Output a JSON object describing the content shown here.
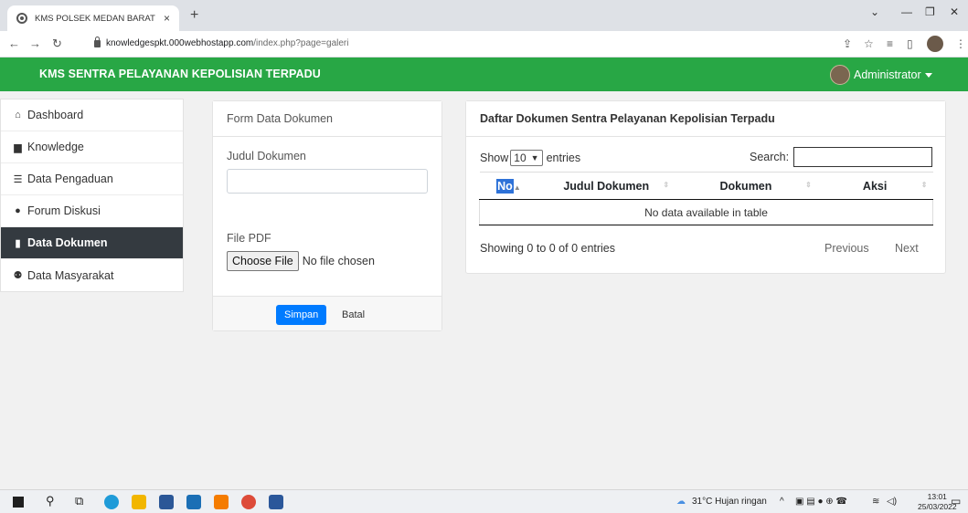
{
  "browser": {
    "tab_title": "KMS POLSEK MEDAN BARAT",
    "tab_close": "×",
    "new_tab": "+",
    "url_host": "knowledgespkt.000webhostapp.com",
    "url_path": "/index.php?page=galeri"
  },
  "navbar": {
    "brand": "KMS SENTRA PELAYANAN KEPOLISIAN TERPADU",
    "user": "Administrator"
  },
  "sidebar": {
    "items": [
      {
        "label": "Dashboard",
        "icon": "home-icon"
      },
      {
        "label": "Knowledge",
        "icon": "book-icon"
      },
      {
        "label": "Data Pengaduan",
        "icon": "list-icon"
      },
      {
        "label": "Forum Diskusi",
        "icon": "comments-icon"
      },
      {
        "label": "Data Dokumen",
        "icon": "file-icon",
        "active": true
      },
      {
        "label": "Data Masyarakat",
        "icon": "users-icon"
      }
    ]
  },
  "form": {
    "header": "Form Data Dokumen",
    "judul_label": "Judul Dokumen",
    "judul_value": "",
    "file_label": "File PDF",
    "choose_file": "Choose File",
    "no_file": "No file chosen",
    "save": "Simpan",
    "cancel": "Batal"
  },
  "table": {
    "header": "Daftar Dokumen Sentra Pelayanan Kepolisian Terpadu",
    "show_label": "Show",
    "entries_value": "10",
    "entries_label": "entries",
    "search_label": "Search:",
    "columns": [
      "No",
      "Judul Dokumen",
      "Dokumen",
      "Aksi"
    ],
    "empty": "No data available in table",
    "info": "Showing 0 to 0 of 0 entries",
    "previous": "Previous",
    "next": "Next"
  },
  "taskbar": {
    "weather": "31°C  Hujan ringan",
    "time": "13:01",
    "date": "25/03/2022"
  },
  "colors": {
    "navbar": "#28a745",
    "active_sidebar": "#343a40",
    "primary": "#007bff"
  }
}
